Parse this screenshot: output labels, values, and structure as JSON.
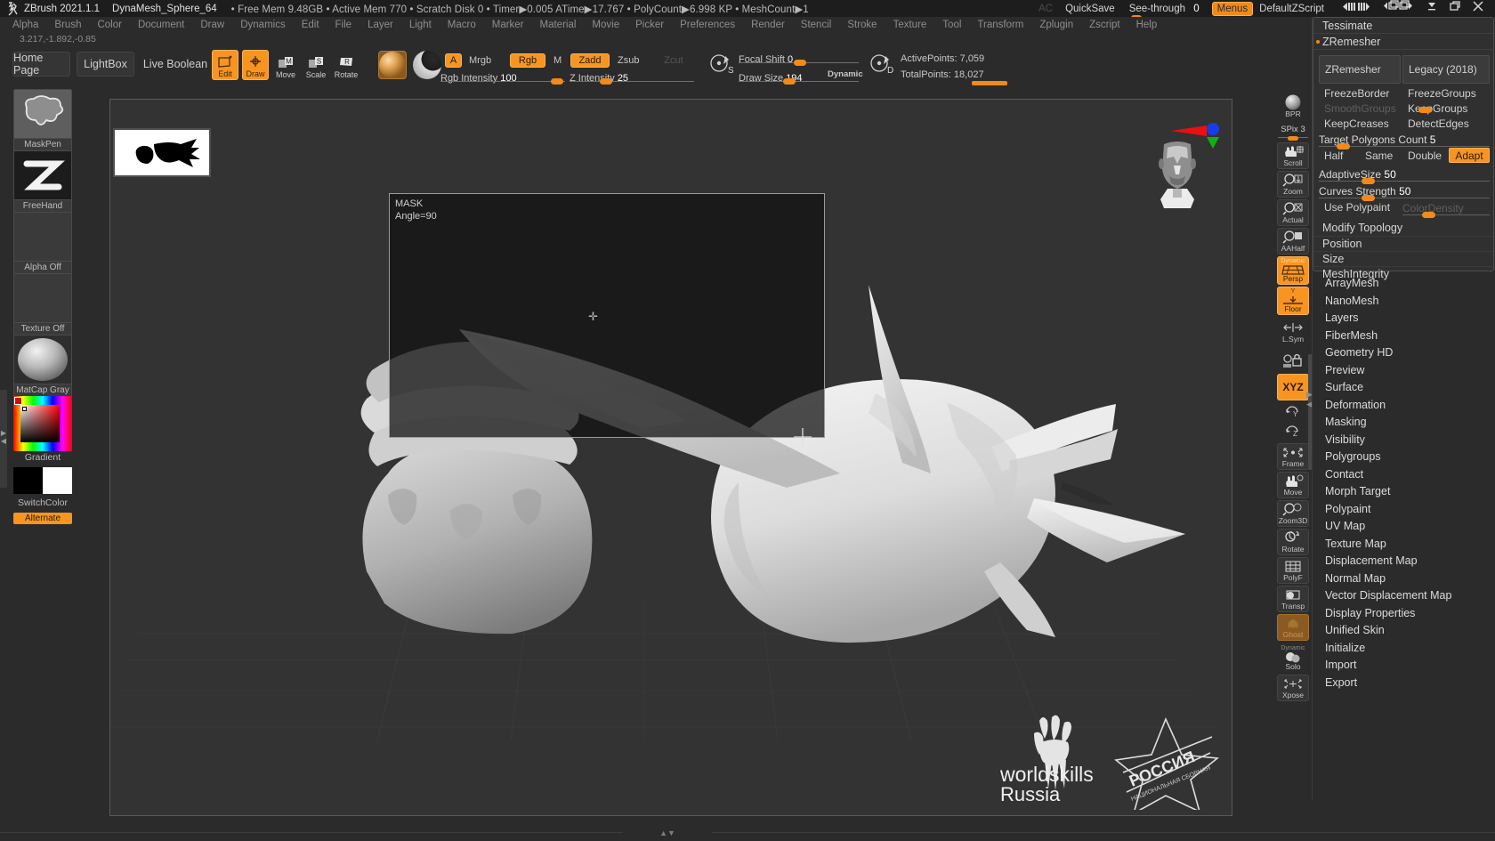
{
  "titlebar": {
    "app": "ZBrush 2021.1.1",
    "document": "DynaMesh_Sphere_64",
    "stats": "• Free Mem 9.48GB • Active Mem 770 • Scratch Disk 0 • Timer▶0.005 ATime▶17.767 • PolyCount▶6.998 KP • MeshCount▶1",
    "ac": "AC",
    "quicksave": "QuickSave",
    "see_through_label": "See-through",
    "see_through_value": "0",
    "menus": "Menus",
    "default_zscript": "DefaultZScript",
    "win_icons": [
      "◀|||",
      "|||▶",
      "◀❑",
      "❑▶",
      "⊻",
      "❐",
      "✕"
    ]
  },
  "menubar": [
    "Alpha",
    "Brush",
    "Color",
    "Document",
    "Draw",
    "Dynamics",
    "Edit",
    "File",
    "Layer",
    "Light",
    "Macro",
    "Marker",
    "Material",
    "Movie",
    "Picker",
    "Preferences",
    "Render",
    "Stencil",
    "Stroke",
    "Texture",
    "Tool",
    "Transform",
    "Zplugin",
    "Zscript",
    "Help"
  ],
  "coords": "3.217,-1.892,-0.85",
  "toolbar": {
    "home_page": "Home Page",
    "lightbox": "LightBox",
    "live_boolean": "Live Boolean",
    "edit": "Edit",
    "draw": "Draw",
    "move": "Move",
    "scale": "Scale",
    "rotate": "Rotate",
    "a": "A",
    "mrgb": "Mrgb",
    "rgb": "Rgb",
    "m": "M",
    "zadd": "Zadd",
    "zsub": "Zsub",
    "zcut": "Zcut",
    "rgb_intensity_label": "Rgb Intensity",
    "rgb_intensity_value": "100",
    "z_intensity_label": "Z Intensity",
    "z_intensity_value": "25",
    "focal_shift_label": "Focal Shift",
    "focal_shift_value": "0",
    "draw_size_label": "Draw Size",
    "draw_size_value": "194",
    "dynamic": "Dynamic",
    "active_points": "ActivePoints: 7,059",
    "total_points": "TotalPoints: 18,027"
  },
  "sidebar": {
    "brush_label": "MaskPen",
    "stroke_label": "FreeHand",
    "alpha_label": "Alpha Off",
    "texture_label": "Texture Off",
    "material_label": "MatCap Gray",
    "gradient_label": "Gradient",
    "switch_color_label": "SwitchColor",
    "alternate_label": "Alternate"
  },
  "canvas": {
    "mask_title": "MASK",
    "mask_angle": "Angle=90",
    "logo_worldskills": "worldskills",
    "logo_worldskills_2": "Russia",
    "logo_russia": "РОССИЯ",
    "logo_russia_sub": "НАЦИОНАЛЬНАЯ СБОРНАЯ"
  },
  "right_strip": [
    {
      "name": "bpr",
      "label": "BPR",
      "state": "bare"
    },
    {
      "name": "spix",
      "label": "SPix",
      "value": "3",
      "state": "slider"
    },
    {
      "name": "scroll",
      "label": "Scroll",
      "state": "off"
    },
    {
      "name": "zoom",
      "label": "Zoom",
      "state": "off"
    },
    {
      "name": "actual",
      "label": "Actual",
      "state": "off"
    },
    {
      "name": "aahalf",
      "label": "AAHalf",
      "state": "off"
    },
    {
      "name": "persp",
      "label": "Persp",
      "state": "on",
      "sublabel": "Dynamic"
    },
    {
      "name": "floor",
      "label": "Floor",
      "state": "on"
    },
    {
      "name": "lsym",
      "label": "L.Sym",
      "state": "off"
    },
    {
      "name": "local",
      "label": "",
      "state": "bare"
    },
    {
      "name": "xyz",
      "label": "XYZ",
      "state": "on"
    },
    {
      "name": "rot-y",
      "label": "",
      "state": "bare"
    },
    {
      "name": "rot-z",
      "label": "",
      "state": "bare"
    },
    {
      "name": "frame",
      "label": "Frame",
      "state": "off"
    },
    {
      "name": "move",
      "label": "Move",
      "state": "off"
    },
    {
      "name": "zoom3d",
      "label": "Zoom3D",
      "state": "off"
    },
    {
      "name": "rotate",
      "label": "Rotate",
      "state": "off"
    },
    {
      "name": "polyf",
      "label": "PolyF",
      "state": "off"
    },
    {
      "name": "transp",
      "label": "Transp",
      "state": "off"
    },
    {
      "name": "ghost",
      "label": "Ghost",
      "state": "amber"
    },
    {
      "name": "solo",
      "label": "Solo",
      "state": "off",
      "sublabel": "Dynamic"
    },
    {
      "name": "xpose",
      "label": "Xpose",
      "state": "off"
    }
  ],
  "palette": {
    "tessimate": "Tessimate",
    "zremesher_header": "ZRemesher",
    "zremesher_btn": "ZRemesher",
    "legacy_btn": "Legacy (2018)",
    "freeze_border": "FreezeBorder",
    "freeze_groups": "FreezeGroups",
    "smooth_groups": "SmoothGroups",
    "keep_groups": "KeepGroups",
    "keep_creases": "KeepCreases",
    "detect_edges": "DetectEdges",
    "target_polygons_label": "Target Polygons Count",
    "target_polygons_value": "5",
    "half": "Half",
    "same": "Same",
    "double": "Double",
    "adapt": "Adapt",
    "adaptive_size_label": "AdaptiveSize",
    "adaptive_size_value": "50",
    "curves_strength_label": "Curves Strength",
    "curves_strength_value": "50",
    "use_polypaint": "Use Polypaint",
    "color_density": "ColorDensity",
    "modify_topology": "Modify Topology",
    "position": "Position",
    "size": "Size",
    "mesh_integrity": "MeshIntegrity"
  },
  "palette_menu": [
    "ArrayMesh",
    "NanoMesh",
    "Layers",
    "FiberMesh",
    "Geometry HD",
    "Preview",
    "Surface",
    "Deformation",
    "Masking",
    "Visibility",
    "Polygroups",
    "Contact",
    "Morph Target",
    "Polypaint",
    "UV Map",
    "Texture Map",
    "Displacement Map",
    "Normal Map",
    "Vector Displacement Map",
    "Display Properties",
    "Unified Skin",
    "Initialize",
    "Import",
    "Export"
  ],
  "colors": {
    "accent": "#f79520",
    "panel_bg": "#2b2b2b",
    "canvas_bg": "#333333",
    "titlebar_bg": "#1d1d1d"
  }
}
